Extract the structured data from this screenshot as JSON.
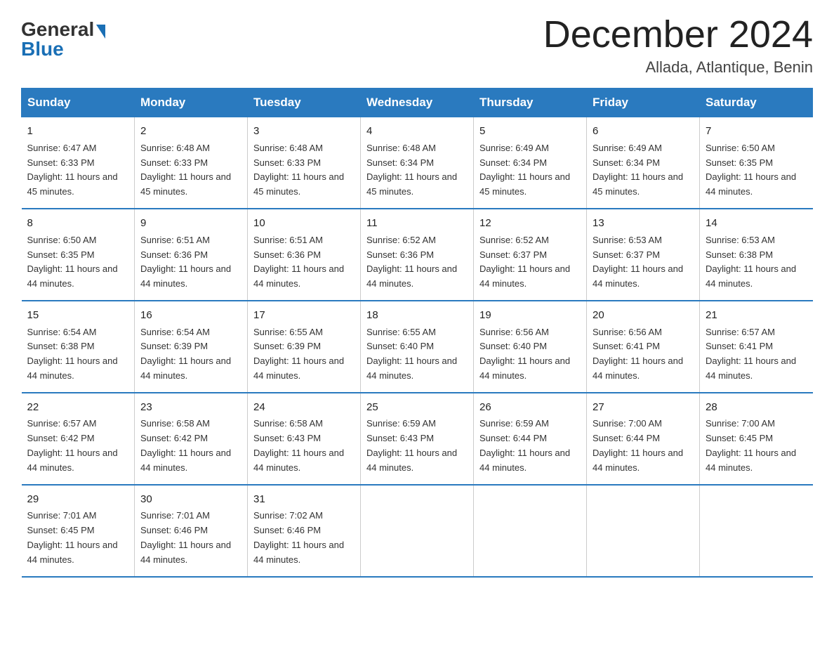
{
  "header": {
    "logo_general": "General",
    "logo_blue": "Blue",
    "month_title": "December 2024",
    "location": "Allada, Atlantique, Benin"
  },
  "days_of_week": [
    "Sunday",
    "Monday",
    "Tuesday",
    "Wednesday",
    "Thursday",
    "Friday",
    "Saturday"
  ],
  "weeks": [
    [
      {
        "day": "1",
        "sunrise": "6:47 AM",
        "sunset": "6:33 PM",
        "daylight": "11 hours and 45 minutes."
      },
      {
        "day": "2",
        "sunrise": "6:48 AM",
        "sunset": "6:33 PM",
        "daylight": "11 hours and 45 minutes."
      },
      {
        "day": "3",
        "sunrise": "6:48 AM",
        "sunset": "6:33 PM",
        "daylight": "11 hours and 45 minutes."
      },
      {
        "day": "4",
        "sunrise": "6:48 AM",
        "sunset": "6:34 PM",
        "daylight": "11 hours and 45 minutes."
      },
      {
        "day": "5",
        "sunrise": "6:49 AM",
        "sunset": "6:34 PM",
        "daylight": "11 hours and 45 minutes."
      },
      {
        "day": "6",
        "sunrise": "6:49 AM",
        "sunset": "6:34 PM",
        "daylight": "11 hours and 45 minutes."
      },
      {
        "day": "7",
        "sunrise": "6:50 AM",
        "sunset": "6:35 PM",
        "daylight": "11 hours and 44 minutes."
      }
    ],
    [
      {
        "day": "8",
        "sunrise": "6:50 AM",
        "sunset": "6:35 PM",
        "daylight": "11 hours and 44 minutes."
      },
      {
        "day": "9",
        "sunrise": "6:51 AM",
        "sunset": "6:36 PM",
        "daylight": "11 hours and 44 minutes."
      },
      {
        "day": "10",
        "sunrise": "6:51 AM",
        "sunset": "6:36 PM",
        "daylight": "11 hours and 44 minutes."
      },
      {
        "day": "11",
        "sunrise": "6:52 AM",
        "sunset": "6:36 PM",
        "daylight": "11 hours and 44 minutes."
      },
      {
        "day": "12",
        "sunrise": "6:52 AM",
        "sunset": "6:37 PM",
        "daylight": "11 hours and 44 minutes."
      },
      {
        "day": "13",
        "sunrise": "6:53 AM",
        "sunset": "6:37 PM",
        "daylight": "11 hours and 44 minutes."
      },
      {
        "day": "14",
        "sunrise": "6:53 AM",
        "sunset": "6:38 PM",
        "daylight": "11 hours and 44 minutes."
      }
    ],
    [
      {
        "day": "15",
        "sunrise": "6:54 AM",
        "sunset": "6:38 PM",
        "daylight": "11 hours and 44 minutes."
      },
      {
        "day": "16",
        "sunrise": "6:54 AM",
        "sunset": "6:39 PM",
        "daylight": "11 hours and 44 minutes."
      },
      {
        "day": "17",
        "sunrise": "6:55 AM",
        "sunset": "6:39 PM",
        "daylight": "11 hours and 44 minutes."
      },
      {
        "day": "18",
        "sunrise": "6:55 AM",
        "sunset": "6:40 PM",
        "daylight": "11 hours and 44 minutes."
      },
      {
        "day": "19",
        "sunrise": "6:56 AM",
        "sunset": "6:40 PM",
        "daylight": "11 hours and 44 minutes."
      },
      {
        "day": "20",
        "sunrise": "6:56 AM",
        "sunset": "6:41 PM",
        "daylight": "11 hours and 44 minutes."
      },
      {
        "day": "21",
        "sunrise": "6:57 AM",
        "sunset": "6:41 PM",
        "daylight": "11 hours and 44 minutes."
      }
    ],
    [
      {
        "day": "22",
        "sunrise": "6:57 AM",
        "sunset": "6:42 PM",
        "daylight": "11 hours and 44 minutes."
      },
      {
        "day": "23",
        "sunrise": "6:58 AM",
        "sunset": "6:42 PM",
        "daylight": "11 hours and 44 minutes."
      },
      {
        "day": "24",
        "sunrise": "6:58 AM",
        "sunset": "6:43 PM",
        "daylight": "11 hours and 44 minutes."
      },
      {
        "day": "25",
        "sunrise": "6:59 AM",
        "sunset": "6:43 PM",
        "daylight": "11 hours and 44 minutes."
      },
      {
        "day": "26",
        "sunrise": "6:59 AM",
        "sunset": "6:44 PM",
        "daylight": "11 hours and 44 minutes."
      },
      {
        "day": "27",
        "sunrise": "7:00 AM",
        "sunset": "6:44 PM",
        "daylight": "11 hours and 44 minutes."
      },
      {
        "day": "28",
        "sunrise": "7:00 AM",
        "sunset": "6:45 PM",
        "daylight": "11 hours and 44 minutes."
      }
    ],
    [
      {
        "day": "29",
        "sunrise": "7:01 AM",
        "sunset": "6:45 PM",
        "daylight": "11 hours and 44 minutes."
      },
      {
        "day": "30",
        "sunrise": "7:01 AM",
        "sunset": "6:46 PM",
        "daylight": "11 hours and 44 minutes."
      },
      {
        "day": "31",
        "sunrise": "7:02 AM",
        "sunset": "6:46 PM",
        "daylight": "11 hours and 44 minutes."
      },
      null,
      null,
      null,
      null
    ]
  ]
}
